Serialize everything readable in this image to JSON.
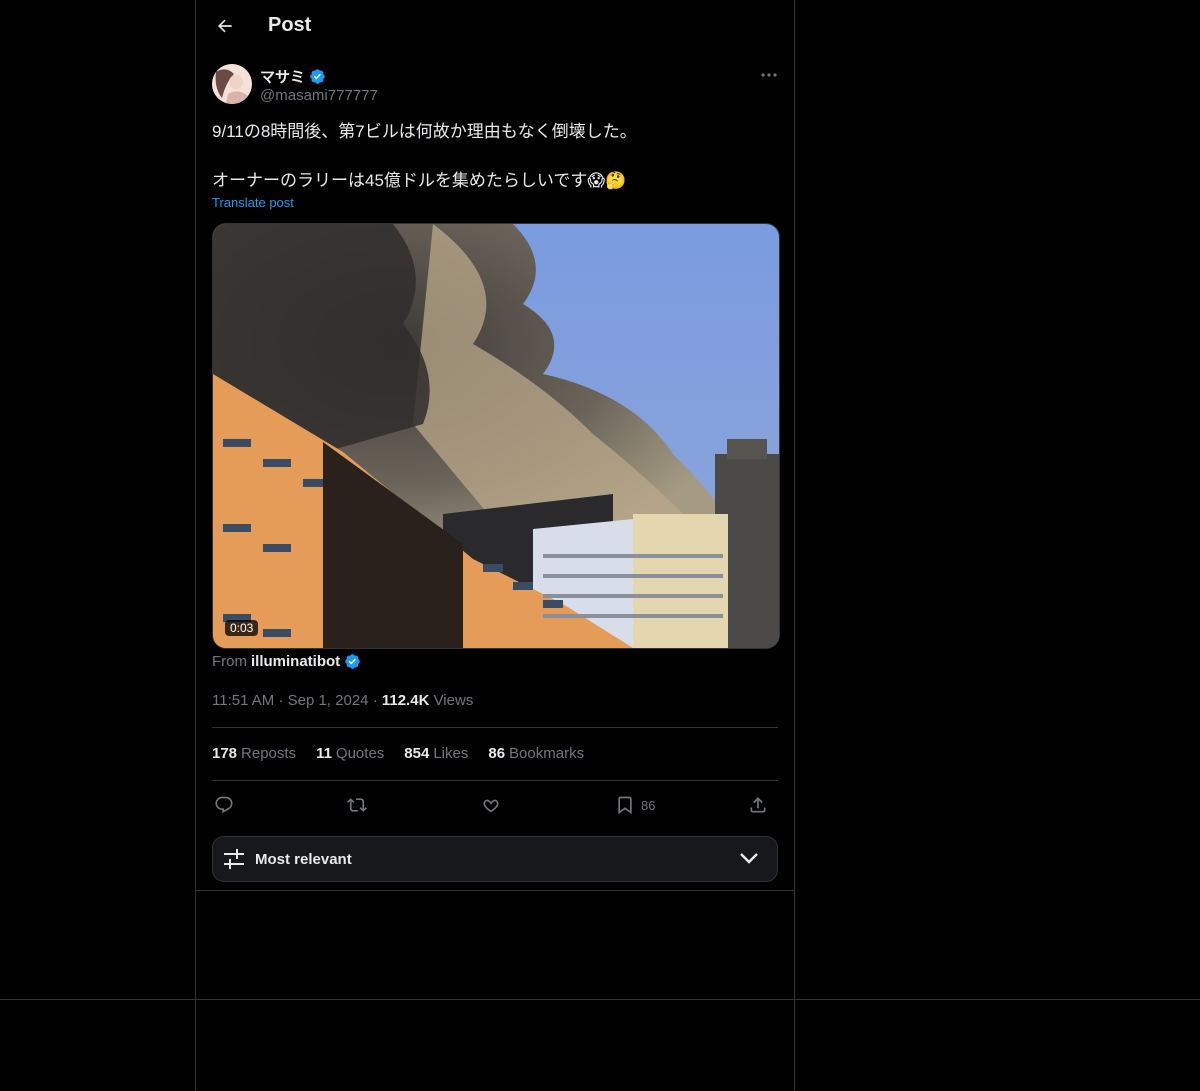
{
  "header": {
    "title": "Post"
  },
  "author": {
    "display_name": "マサミ",
    "handle": "@masami777777",
    "verified": true
  },
  "post": {
    "line1": "9/11の8時間後、第7ビルは何故か理由もなく倒壊した。",
    "line2": "オーナーのラリーは45億ドルを集めたらしいです😱🤔",
    "translate_label": "Translate post"
  },
  "media": {
    "duration": "0:03"
  },
  "source": {
    "prefix": "From",
    "name": "illuminatibot"
  },
  "meta": {
    "time": "11:51 AM",
    "date": "Sep 1, 2024",
    "views_count": "112.4K",
    "views_label": "Views",
    "separator": "·"
  },
  "stats": {
    "reposts": {
      "count": "178",
      "label": "Reposts"
    },
    "quotes": {
      "count": "11",
      "label": "Quotes"
    },
    "likes": {
      "count": "854",
      "label": "Likes"
    },
    "bookmarks": {
      "count": "86",
      "label": "Bookmarks"
    }
  },
  "actions": {
    "bookmark_count": "86"
  },
  "sort": {
    "label": "Most relevant"
  },
  "colors": {
    "accent": "#1d9bf0",
    "background": "#000000",
    "text": "#e7e9ea",
    "muted": "#71767b",
    "border": "#2f3336"
  }
}
